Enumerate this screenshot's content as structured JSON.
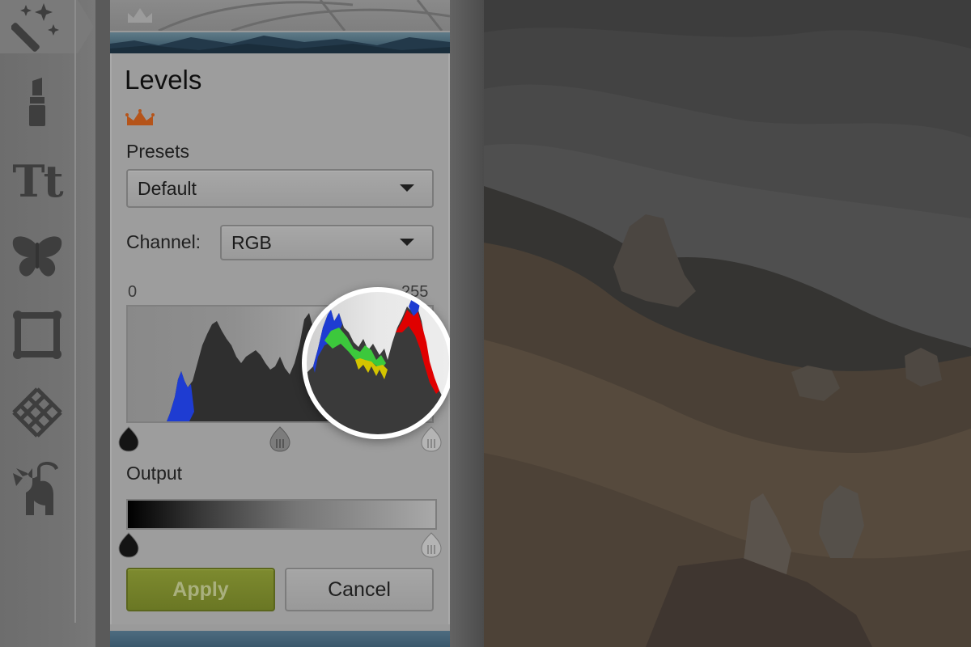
{
  "toolbar": {
    "items": [
      {
        "name": "effects",
        "icon": "magic-wand-icon"
      },
      {
        "name": "touch-up",
        "icon": "lipstick-icon"
      },
      {
        "name": "text",
        "icon": "text-icon",
        "glyph": "Tt"
      },
      {
        "name": "overlays",
        "icon": "butterfly-icon"
      },
      {
        "name": "frames",
        "icon": "frame-icon"
      },
      {
        "name": "textures",
        "icon": "texture-icon"
      },
      {
        "name": "themes",
        "icon": "cat-icon"
      }
    ]
  },
  "panel": {
    "title": "Levels",
    "premium_icon": "crown-icon",
    "presets": {
      "label": "Presets",
      "selected": "Default"
    },
    "channel": {
      "label": "Channel:",
      "selected": "RGB"
    },
    "histogram": {
      "min_label": "0",
      "max_label": "255",
      "input_levels": {
        "black": 0,
        "midtone": 0.5,
        "white": 1
      }
    },
    "output": {
      "label": "Output",
      "levels": {
        "black": 0,
        "white": 1
      }
    },
    "apply_label": "Apply",
    "cancel_label": "Cancel"
  },
  "colors": {
    "apply_button": "#7d8a2f",
    "crown": "#b5541a",
    "histogram_red": "#e00000",
    "histogram_green": "#3cc83c",
    "histogram_blue": "#1e3cd2"
  }
}
